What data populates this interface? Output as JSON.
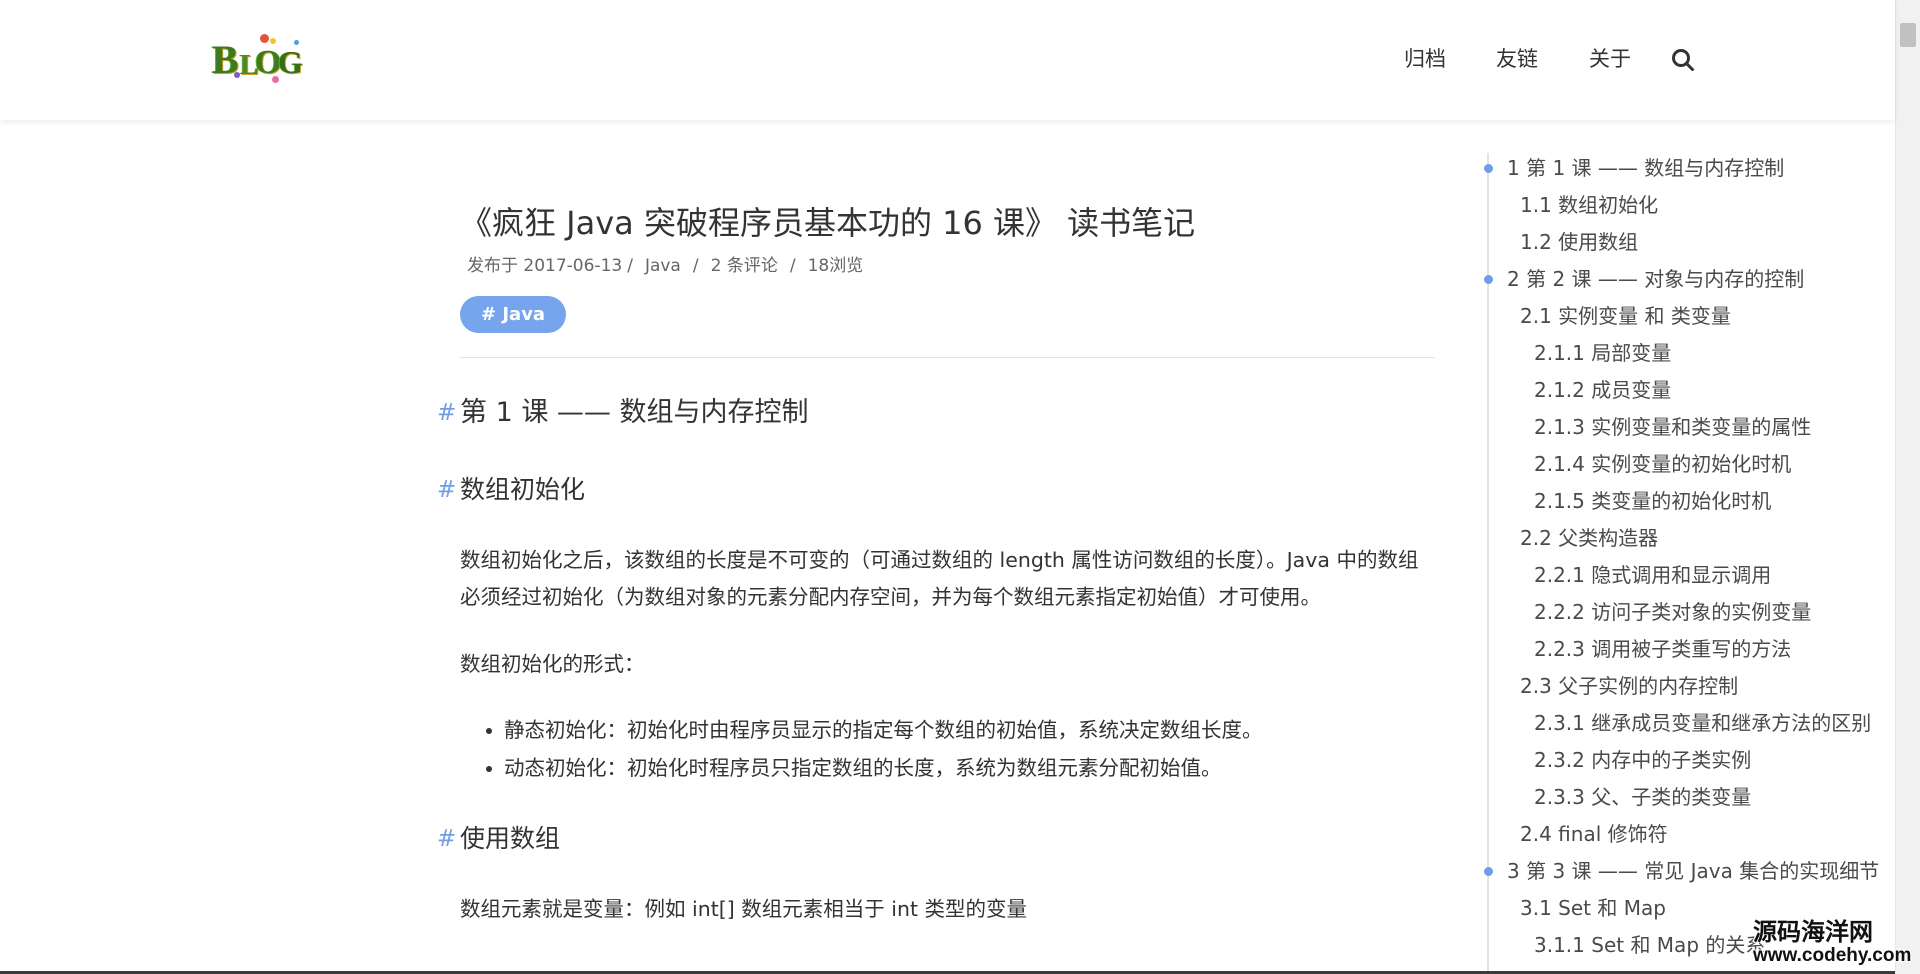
{
  "site": {
    "logo": {
      "letters": [
        "B",
        "L",
        "O",
        "G"
      ]
    },
    "nav": [
      {
        "label": "归档"
      },
      {
        "label": "友链"
      },
      {
        "label": "关于"
      }
    ],
    "search_icon": "search-icon"
  },
  "article": {
    "title": "《疯狂 Java 突破程序员基本功的 16 课》 读书笔记",
    "meta": {
      "published": "发布于 2017-06-13",
      "separator": "/",
      "category": "Java",
      "comments": "2 条评论",
      "views": "18浏览"
    },
    "tag": "# Java",
    "anchor_symbol": "#",
    "h_lesson1": "第 1 课 —— 数组与内存控制",
    "h_array_init": "数组初始化",
    "p_array_init": "数组初始化之后，该数组的长度是不可变的（可通过数组的 length 属性访问数组的长度）。Java 中的数组必须经过初始化（为数组对象的元素分配内存空间，并为每个数组元素指定初始值）才可使用。",
    "p_forms": "数组初始化的形式：",
    "list_forms": [
      "静态初始化：初始化时由程序员显示的指定每个数组的初始值，系统决定数组长度。",
      "动态初始化：初始化时程序员只指定数组的长度，系统为数组元素分配初始值。"
    ],
    "h_use_array": "使用数组",
    "p_use_array": "数组元素就是变量：例如 int[] 数组元素相当于 int 类型的变量"
  },
  "toc": {
    "items": [
      {
        "label": "1 第 1 课 —— 数组与内存控制"
      },
      {
        "label": "1.1 数组初始化"
      },
      {
        "label": "1.2 使用数组"
      },
      {
        "label": "2 第 2 课 —— 对象与内存的控制"
      },
      {
        "label": "2.1 实例变量 和 类变量"
      },
      {
        "label": "2.1.1 局部变量"
      },
      {
        "label": "2.1.2 成员变量"
      },
      {
        "label": "2.1.3 实例变量和类变量的属性"
      },
      {
        "label": "2.1.4 实例变量的初始化时机"
      },
      {
        "label": "2.1.5 类变量的初始化时机"
      },
      {
        "label": "2.2 父类构造器"
      },
      {
        "label": "2.2.1 隐式调用和显示调用"
      },
      {
        "label": "2.2.2 访问子类对象的实例变量"
      },
      {
        "label": "2.2.3 调用被子类重写的方法"
      },
      {
        "label": "2.3 父子实例的内存控制"
      },
      {
        "label": "2.3.1 继承成员变量和继承方法的区别"
      },
      {
        "label": "2.3.2 内存中的子类实例"
      },
      {
        "label": "2.3.3 父、子类的类变量"
      },
      {
        "label": "2.4 final 修饰符"
      },
      {
        "label": "3 第 3 课 —— 常见 Java 集合的实现细节"
      },
      {
        "label": "3.1 Set 和 Map"
      },
      {
        "label": "3.1.1 Set 和 Map 的关系"
      }
    ]
  },
  "watermark": {
    "line1": "源码海洋网",
    "line2": "www.codehy.com"
  },
  "theme": {
    "accent": "#6f9de6",
    "tag_background": "#76a5ee",
    "text": "#333333",
    "muted": "#666666"
  }
}
